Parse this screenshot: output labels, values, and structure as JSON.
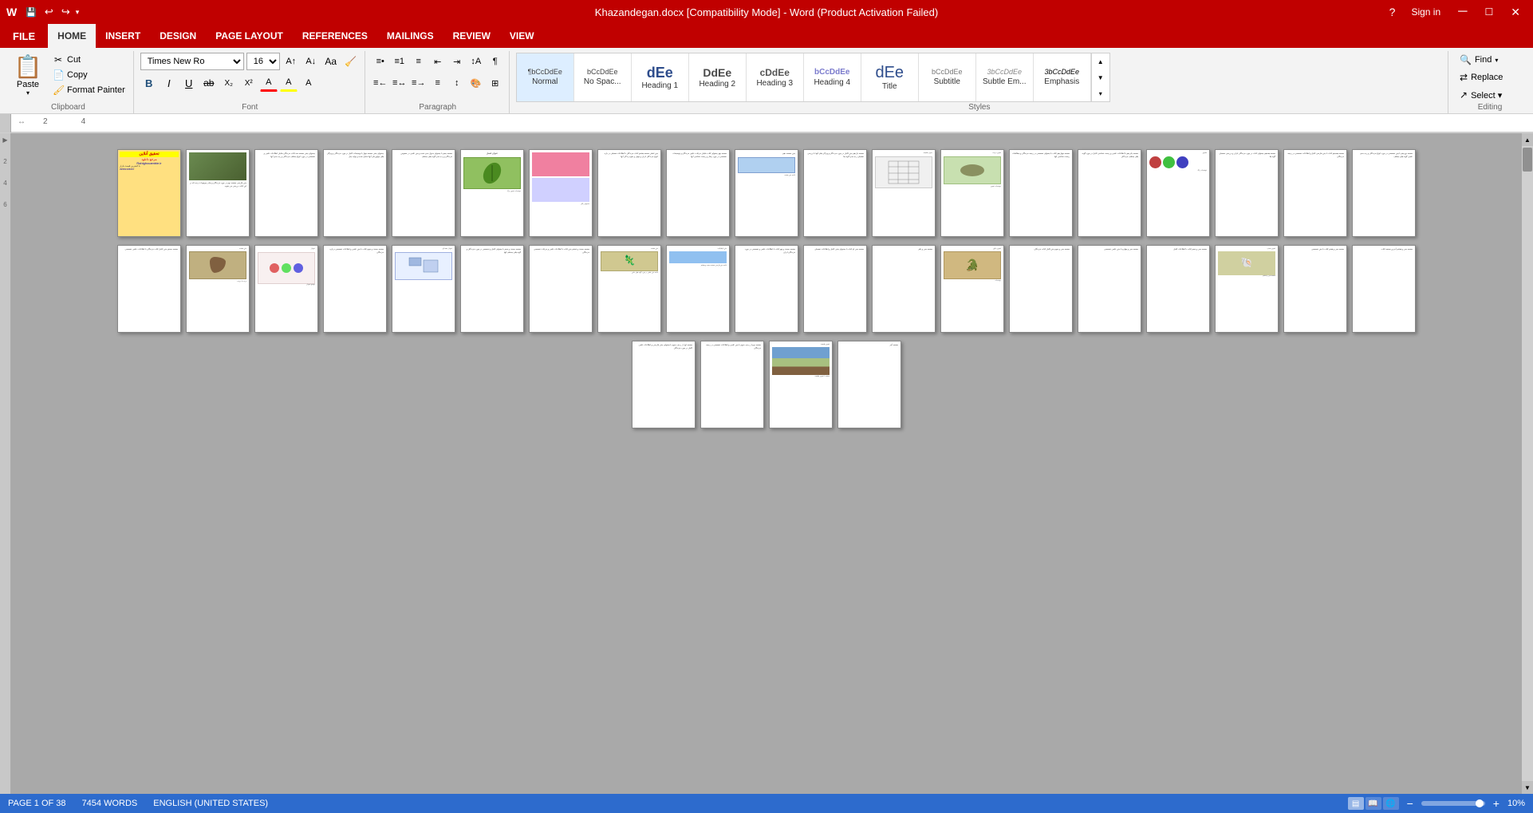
{
  "titleBar": {
    "title": "Khazandegan.docx [Compatibility Mode] - Word (Product Activation Failed)",
    "buttons": [
      "minimize",
      "maximize",
      "close"
    ]
  },
  "quickAccess": {
    "save": "💾",
    "undo": "↩",
    "redo": "↪"
  },
  "tabs": {
    "file": "FILE",
    "items": [
      "HOME",
      "INSERT",
      "DESIGN",
      "PAGE LAYOUT",
      "REFERENCES",
      "MAILINGS",
      "REVIEW",
      "VIEW"
    ],
    "active": "HOME"
  },
  "clipboard": {
    "paste": "Paste",
    "cut": "Cut",
    "copy": "Copy",
    "formatPainter": "Format Painter",
    "label": "Clipboard"
  },
  "font": {
    "fontName": "Times New Ro",
    "fontSize": "16",
    "label": "Font"
  },
  "paragraph": {
    "label": "Paragraph"
  },
  "styles": {
    "label": "Styles",
    "items": [
      {
        "label": "Normal",
        "preview": "¶bCcDdEe",
        "active": true
      },
      {
        "label": "No Spac...",
        "preview": "bCcDdEe"
      },
      {
        "label": "Heading 1",
        "preview": "dEe"
      },
      {
        "label": "Heading 2",
        "preview": "DdEe"
      },
      {
        "label": "Heading 3",
        "preview": "cDdEe"
      },
      {
        "label": "Heading 4",
        "preview": "bCcDdEe"
      },
      {
        "label": "Title",
        "preview": "dEe"
      },
      {
        "label": "Subtitle",
        "preview": "bCcDdEe"
      },
      {
        "label": "Subtle Em...",
        "preview": "3bCcDdEe"
      },
      {
        "label": "Emphasis",
        "preview": "3bCcDdEe"
      }
    ]
  },
  "editing": {
    "label": "Editing",
    "find": "Find",
    "replace": "Replace",
    "select": "Select ▾"
  },
  "statusBar": {
    "page": "PAGE 1 OF 38",
    "words": "7454 WORDS",
    "language": "ENGLISH (UNITED STATES)",
    "zoom": "10%"
  },
  "ruler": {
    "marks": [
      "2",
      "4"
    ]
  },
  "pages": {
    "row1Count": 19,
    "row2Count": 19,
    "row3Count": 4
  }
}
